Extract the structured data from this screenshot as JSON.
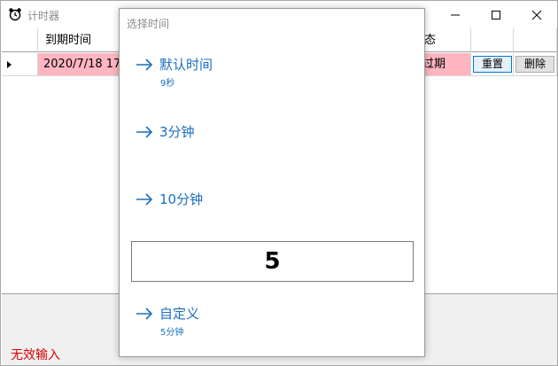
{
  "window": {
    "title": "计时器"
  },
  "grid": {
    "headers": {
      "due_time": "到期时间",
      "status": "态"
    },
    "row": {
      "due_time": "2020/7/18 17",
      "status": "过期",
      "reset_label": "重置",
      "delete_label": "删除"
    }
  },
  "status_bar": {
    "message": "无效输入"
  },
  "popup": {
    "title": "选择时间",
    "options": [
      {
        "label": "默认时间",
        "sub": "9秒"
      },
      {
        "label": "3分钟",
        "sub": ""
      },
      {
        "label": "10分钟",
        "sub": ""
      },
      {
        "label": "自定义",
        "sub": "5分钟"
      }
    ],
    "input_value": "5"
  },
  "colors": {
    "accent": "#1a6fbf",
    "row_expired": "#ffb6c1",
    "error": "#e00000"
  },
  "icons": {
    "app": "alarm-clock-icon",
    "option": "arrow-right-icon"
  }
}
